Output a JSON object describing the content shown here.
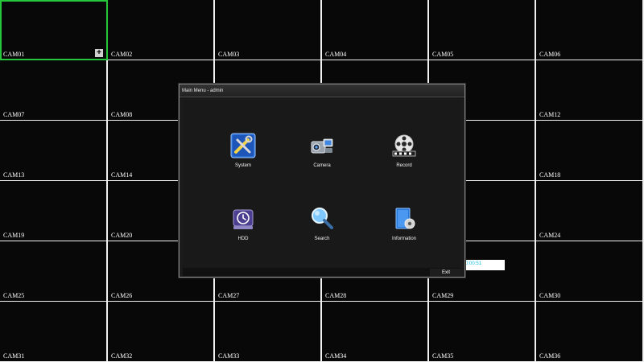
{
  "cameras": [
    {
      "label": "CAM01"
    },
    {
      "label": "CAM02"
    },
    {
      "label": "CAM03"
    },
    {
      "label": "CAM04"
    },
    {
      "label": "CAM05"
    },
    {
      "label": "CAM06"
    },
    {
      "label": "CAM07"
    },
    {
      "label": "CAM08"
    },
    {
      "label": "CAM09"
    },
    {
      "label": "CAM10"
    },
    {
      "label": "CAM11"
    },
    {
      "label": "CAM12"
    },
    {
      "label": "CAM13"
    },
    {
      "label": "CAM14"
    },
    {
      "label": "CAM15"
    },
    {
      "label": "CAM16"
    },
    {
      "label": "CAM17"
    },
    {
      "label": "CAM18"
    },
    {
      "label": "CAM19"
    },
    {
      "label": "CAM20"
    },
    {
      "label": "CAM21"
    },
    {
      "label": "CAM22"
    },
    {
      "label": "CAM23"
    },
    {
      "label": "CAM24"
    },
    {
      "label": "CAM25"
    },
    {
      "label": "CAM26"
    },
    {
      "label": "CAM27"
    },
    {
      "label": "CAM28"
    },
    {
      "label": "CAM29"
    },
    {
      "label": "CAM30"
    },
    {
      "label": "CAM31"
    },
    {
      "label": "CAM32"
    },
    {
      "label": "CAM33"
    },
    {
      "label": "CAM34"
    },
    {
      "label": "CAM35"
    },
    {
      "label": "CAM36"
    }
  ],
  "selected_camera": "CAM01",
  "selection_color": "#27c63a",
  "osd_text": "0:00:51",
  "menu": {
    "title": "Main Menu - admin",
    "items": [
      {
        "label": "System",
        "icon": "system-tools-icon"
      },
      {
        "label": "Camera",
        "icon": "camera-icon"
      },
      {
        "label": "Record",
        "icon": "film-reel-icon"
      },
      {
        "label": "HDD",
        "icon": "hdd-icon"
      },
      {
        "label": "Search",
        "icon": "magnifier-icon"
      },
      {
        "label": "Information",
        "icon": "information-icon"
      }
    ],
    "exit_label": "Exit"
  }
}
